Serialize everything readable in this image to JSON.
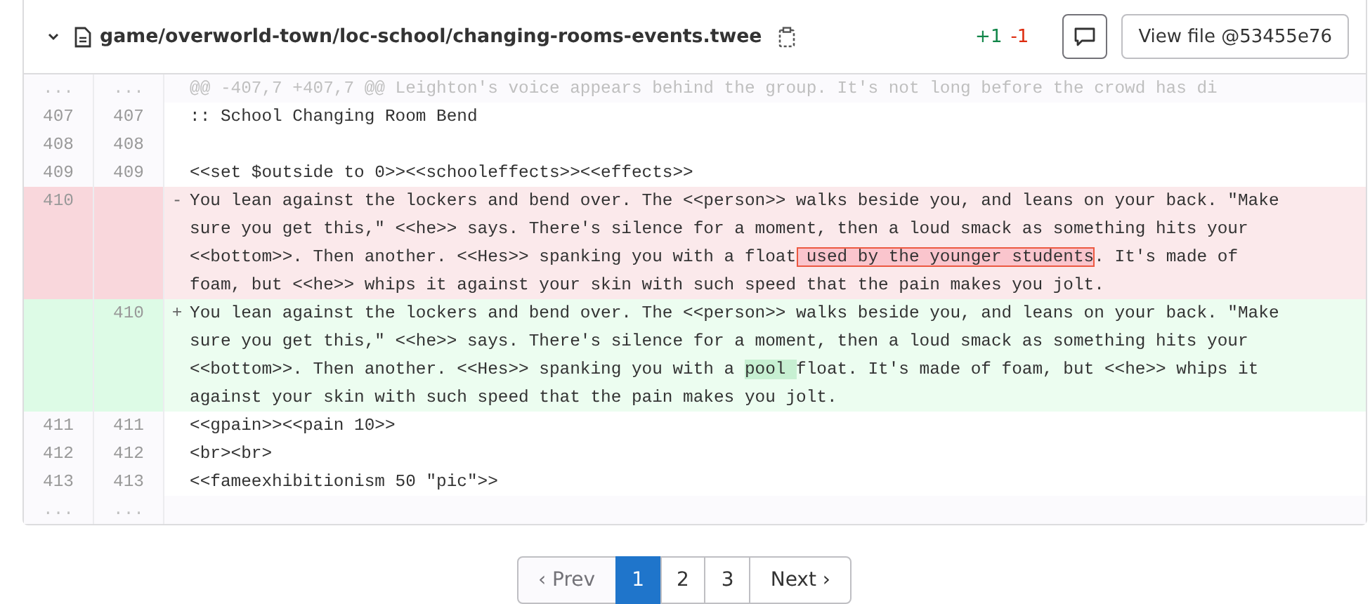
{
  "file_header": {
    "expanded": true,
    "path": "game/overworld-town/loc-school/changing-rooms-events.twee",
    "additions": "+1",
    "deletions": "-1",
    "view_button": "View file @53455e76"
  },
  "diff_rows": [
    {
      "kind": "expander",
      "old_no": "...",
      "new_no": "...",
      "lines": [
        [
          {
            "text": "@@ -407,7 +407,7 @@ Leighton's voice appears behind the group. It's not long before the crowd has di",
            "changed": false
          }
        ]
      ]
    },
    {
      "kind": "context",
      "old_no": "407",
      "new_no": "407",
      "lines": [
        [
          {
            "text": ":: School Changing Room Bend",
            "changed": false
          }
        ]
      ]
    },
    {
      "kind": "context",
      "old_no": "408",
      "new_no": "408",
      "lines": []
    },
    {
      "kind": "context",
      "old_no": "409",
      "new_no": "409",
      "lines": [
        [
          {
            "text": "<<set $outside to 0>><<schooleffects>><<effects>>",
            "changed": false
          }
        ]
      ]
    },
    {
      "kind": "old",
      "old_no": "410",
      "sign": "-",
      "lines": [
        [
          {
            "text": "You lean against the lockers and bend over. The <<person>> walks beside you, and leans on your back. \"Make",
            "changed": false
          }
        ],
        [
          {
            "text": "sure you get this,\" <<he>> says. There's silence for a moment, then a loud smack as something hits your",
            "changed": false
          }
        ],
        [
          {
            "text": "<<bottom>>. Then another. <<Hes>> spanking you with a float",
            "changed": false
          },
          {
            "text": " used by the younger students",
            "changed": true
          },
          {
            "text": ". It's made of",
            "changed": false
          }
        ],
        [
          {
            "text": "foam, but <<he>> whips it against your skin with such speed that the pain makes you jolt.",
            "changed": false
          }
        ]
      ]
    },
    {
      "kind": "new",
      "new_no": "410",
      "sign": "+",
      "lines": [
        [
          {
            "text": "You lean against the lockers and bend over. The <<person>> walks beside you, and leans on your back. \"Make",
            "changed": false
          }
        ],
        [
          {
            "text": "sure you get this,\" <<he>> says. There's silence for a moment, then a loud smack as something hits your",
            "changed": false
          }
        ],
        [
          {
            "text": "<<bottom>>. Then another. <<Hes>> spanking you with a ",
            "changed": false
          },
          {
            "text": "pool ",
            "changed": true
          },
          {
            "text": "float. It's made of foam, but <<he>> whips it",
            "changed": false
          }
        ],
        [
          {
            "text": "against your skin with such speed that the pain makes you jolt.",
            "changed": false
          }
        ]
      ]
    },
    {
      "kind": "context",
      "old_no": "411",
      "new_no": "411",
      "lines": [
        [
          {
            "text": "<<gpain>><<pain 10>>",
            "changed": false
          }
        ]
      ]
    },
    {
      "kind": "context",
      "old_no": "412",
      "new_no": "412",
      "lines": [
        [
          {
            "text": "<br><br>",
            "changed": false
          }
        ]
      ]
    },
    {
      "kind": "context",
      "old_no": "413",
      "new_no": "413",
      "lines": [
        [
          {
            "text": "<<fameexhibitionism 50 \"pic\">>",
            "changed": false
          }
        ]
      ]
    },
    {
      "kind": "expander",
      "old_no": "...",
      "new_no": "...",
      "lines": []
    }
  ],
  "pagination": [
    {
      "label": "‹ Prev",
      "kind": "prev",
      "selected": false,
      "disabled": true
    },
    {
      "label": "1",
      "kind": "page",
      "selected": true,
      "disabled": false
    },
    {
      "label": "2",
      "kind": "page",
      "selected": false,
      "disabled": false
    },
    {
      "label": "3",
      "kind": "page",
      "selected": false,
      "disabled": false
    },
    {
      "label": "Next ›",
      "kind": "next",
      "selected": false,
      "disabled": false
    }
  ]
}
